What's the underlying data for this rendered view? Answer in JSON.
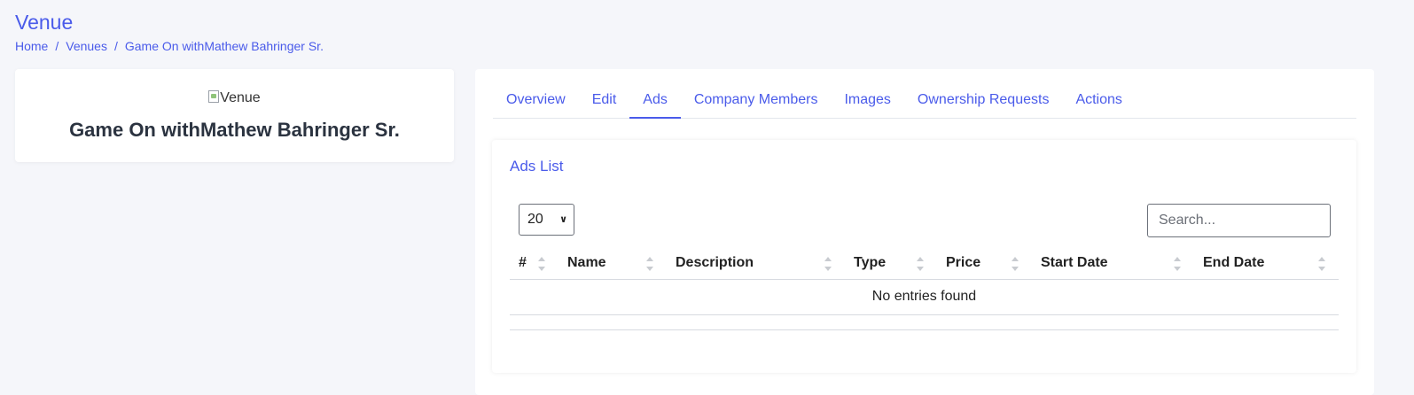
{
  "header": {
    "title": "Venue",
    "breadcrumb": [
      "Home",
      "Venues",
      "Game On withMathew Bahringer Sr."
    ],
    "breadcrumb_separator": "/"
  },
  "venue": {
    "image_alt": "Venue",
    "name": "Game On withMathew Bahringer Sr."
  },
  "tabs": [
    {
      "label": "Overview",
      "active": false
    },
    {
      "label": "Edit",
      "active": false
    },
    {
      "label": "Ads",
      "active": true
    },
    {
      "label": "Company Members",
      "active": false
    },
    {
      "label": "Images",
      "active": false
    },
    {
      "label": "Ownership Requests",
      "active": false
    },
    {
      "label": "Actions",
      "active": false
    }
  ],
  "ads": {
    "title": "Ads List",
    "page_length": "20",
    "search_placeholder": "Search...",
    "columns": [
      "#",
      "Name",
      "Description",
      "Type",
      "Price",
      "Start Date",
      "End Date"
    ],
    "empty_message": "No entries found"
  },
  "colors": {
    "accent": "#4a5bea",
    "background": "#f5f6fa",
    "card": "#ffffff"
  }
}
